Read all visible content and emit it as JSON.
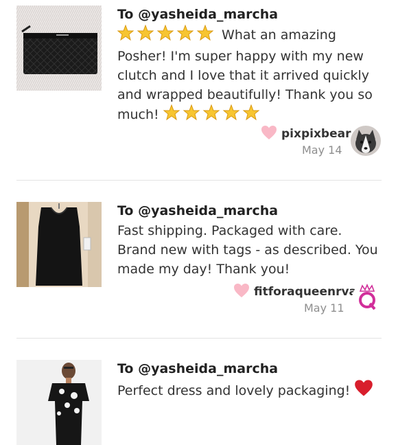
{
  "reviews": [
    {
      "recipient": "To @yasheida_marcha",
      "text_before": "What an amazing Posher! I'm super happy with my new clutch and I love that it arrived quickly and wrapped beautifully! Thank you so much!",
      "reviewer": "pixpixbear",
      "date": "May 14",
      "thumbnail_icon": "black-quilted-clutch-photo",
      "avatar_icon": "husky-dog-avatar"
    },
    {
      "recipient": "To @yasheida_marcha",
      "text": "Fast shipping. Packaged with care. Brand new with tags - as described. You made my day! Thank you!",
      "reviewer": "fitforaqueenrva",
      "date": "May 11",
      "thumbnail_icon": "black-tank-top-photo",
      "avatar_icon": "crowned-q-logo-avatar"
    },
    {
      "recipient": "To @yasheida_marcha",
      "text": "Perfect dress and lovely packaging!",
      "thumbnail_icon": "floral-dress-model-photo"
    }
  ],
  "colors": {
    "heart_pink": "#f9b8c6",
    "star_gold": "#f7c531",
    "red_heart": "#d81e2c",
    "divider": "#e3e3e3",
    "date_gray": "#8e8e8e"
  }
}
